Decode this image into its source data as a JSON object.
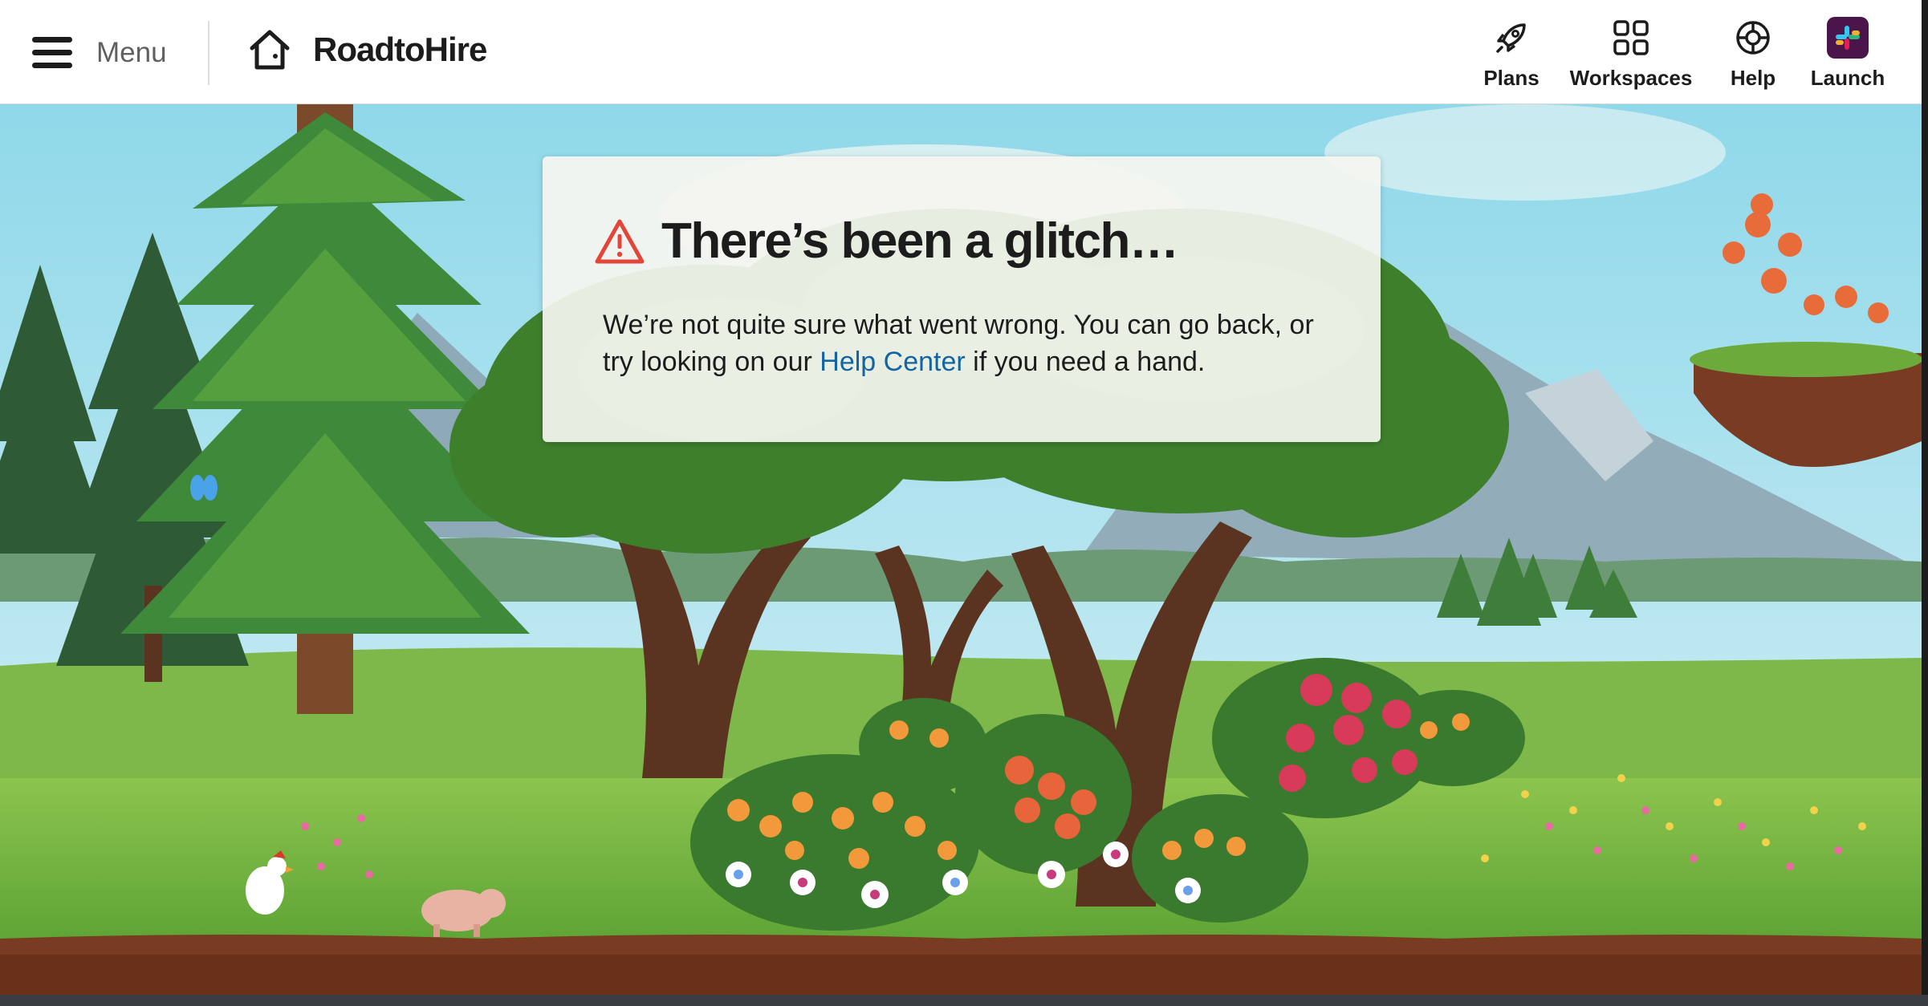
{
  "header": {
    "menu_label": "Menu",
    "brand_name": "RoadtoHire",
    "nav": [
      {
        "label": "Plans",
        "icon": "rocket-icon"
      },
      {
        "label": "Workspaces",
        "icon": "grid-icon"
      },
      {
        "label": "Help",
        "icon": "lifebuoy-icon"
      },
      {
        "label": "Launch",
        "icon": "slack-logo-icon"
      }
    ]
  },
  "error_card": {
    "title": "There’s been a glitch…",
    "body_before": "We’re not quite sure what went wrong. You can go back, or try looking on our ",
    "link_text": "Help Center",
    "body_after": " if you need a hand.",
    "icon": "warning-icon",
    "icon_color": "#e01e5a"
  },
  "colors": {
    "link": "#1264a3",
    "text": "#1d1c1d",
    "sky": "#bfe9f4",
    "grass": "#6cab3b",
    "soil": "#7a3b23"
  }
}
